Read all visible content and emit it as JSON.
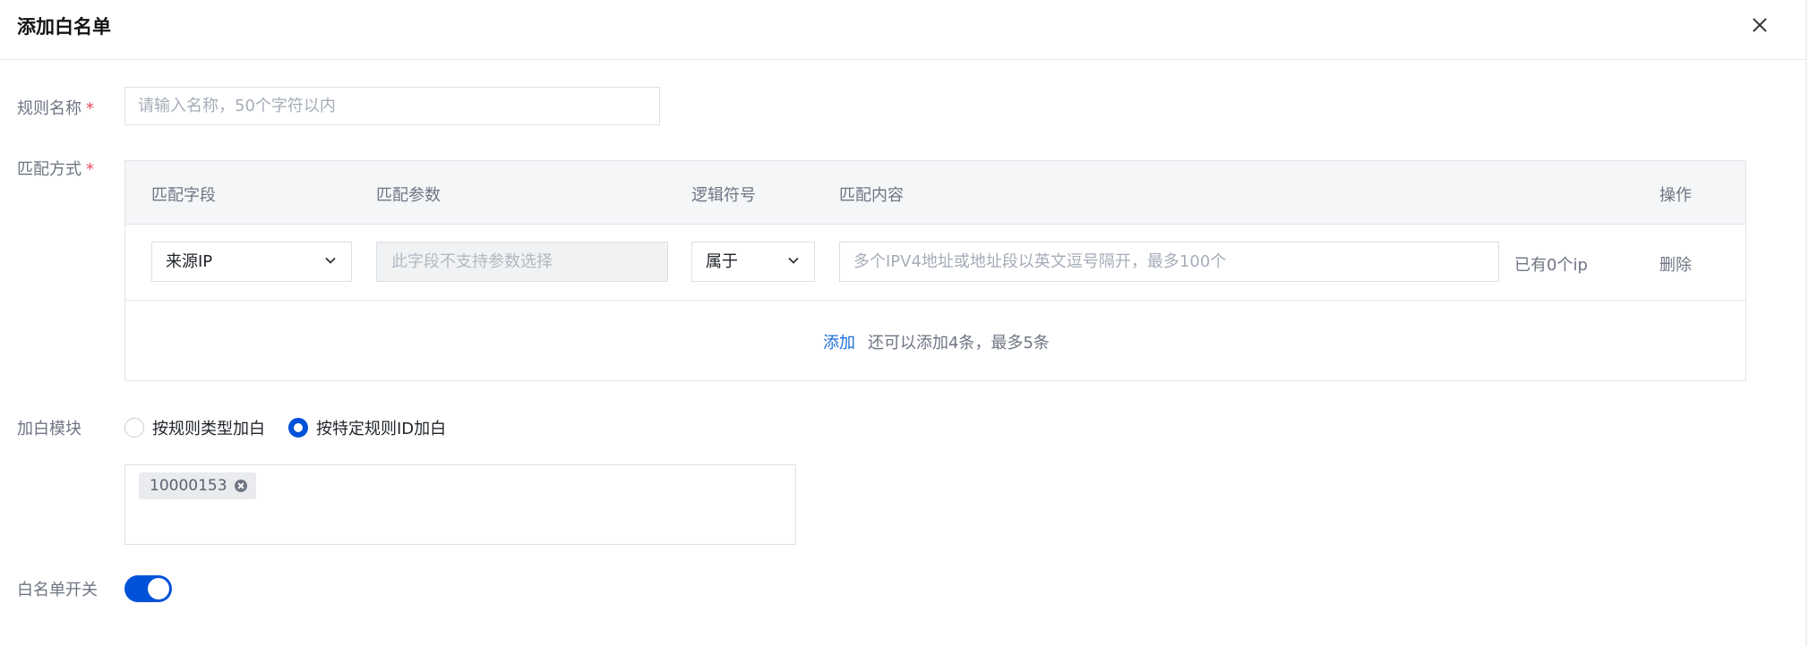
{
  "dialog": {
    "title": "添加白名单"
  },
  "form": {
    "rule_name": {
      "label": "规则名称",
      "placeholder": "请输入名称，50个字符以内",
      "value": ""
    },
    "match_method": {
      "label": "匹配方式",
      "columns": [
        "匹配字段",
        "匹配参数",
        "逻辑符号",
        "匹配内容",
        "操作"
      ],
      "rows": [
        {
          "field": "来源IP",
          "param_placeholder": "此字段不支持参数选择",
          "operator": "属于",
          "content_placeholder": "多个IPV4地址或地址段以英文逗号隔开，最多100个",
          "ip_count": "已有0个ip",
          "action": "删除"
        }
      ],
      "add_label": "添加",
      "add_hint": "还可以添加4条，最多5条"
    },
    "whitelist_module": {
      "label": "加白模块",
      "options": [
        {
          "label": "按规则类型加白",
          "checked": false
        },
        {
          "label": "按特定规则ID加白",
          "checked": true
        }
      ],
      "tags": [
        "10000153"
      ]
    },
    "whitelist_switch": {
      "label": "白名单开关",
      "on": true
    }
  },
  "required_mark": "*",
  "colors": {
    "accent": "#0052d9",
    "link": "#1f6fd9",
    "required": "#e34d59"
  },
  "icons": {
    "close": "close-icon",
    "dropdown": "chevron-down-icon",
    "tag_remove": "tag-remove-icon"
  }
}
